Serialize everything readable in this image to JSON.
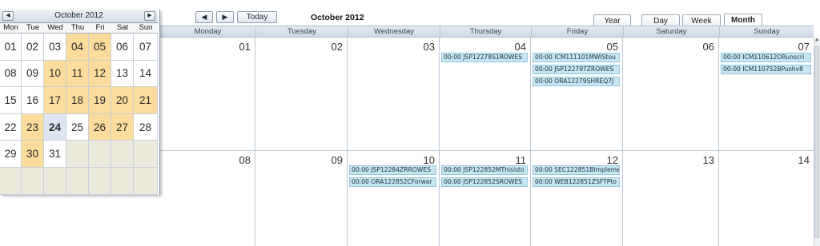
{
  "toolbar": {
    "prev_label": "◀",
    "next_label": "▶",
    "today_label": "Today",
    "month_title": "October 2012",
    "views": [
      "Year",
      "Day",
      "Week",
      "Month"
    ],
    "active_view": "Month"
  },
  "weekdays": [
    "Monday",
    "Tuesday",
    "Wednesday",
    "Thursday",
    "Friday",
    "Saturday",
    "Sunday"
  ],
  "weeks": [
    {
      "days": [
        {
          "num": "01",
          "events": []
        },
        {
          "num": "02",
          "events": []
        },
        {
          "num": "03",
          "events": []
        },
        {
          "num": "04",
          "events": [
            "00:00 JSP12278S1ROWES"
          ]
        },
        {
          "num": "05",
          "events": [
            "00:00 ICM111101MWIStou",
            "00:00 JSP12279TZROWES",
            "00:00 ORA12279SHREQ7J"
          ]
        },
        {
          "num": "06",
          "events": []
        },
        {
          "num": "07",
          "events": [
            "00:00 ICM110612ORunscri",
            "00:00 ICM110752BPushv8"
          ]
        }
      ]
    },
    {
      "days": [
        {
          "num": "08",
          "events": []
        },
        {
          "num": "09",
          "events": []
        },
        {
          "num": "10",
          "events": [
            "00:00 JSP12284ZRROWES",
            "00:00 ORA122852CForwar"
          ]
        },
        {
          "num": "11",
          "events": [
            "00:00 JSP122852MThisisto",
            "00:00 JSP122852SROWES"
          ]
        },
        {
          "num": "12",
          "events": [
            "00:00 SEC122851BImpleme",
            "00:00 WEB122851ZSFTPto"
          ]
        },
        {
          "num": "13",
          "events": []
        },
        {
          "num": "14",
          "events": []
        }
      ]
    }
  ],
  "mini_calendar": {
    "title": "October 2012",
    "prev_label": "◀",
    "next_label": "▶",
    "dow": [
      "Mon",
      "Tue",
      "Wed",
      "Thu",
      "Fri",
      "Sat",
      "Sun"
    ],
    "weeks": [
      [
        {
          "d": "01"
        },
        {
          "d": "02"
        },
        {
          "d": "03"
        },
        {
          "d": "04",
          "ev": true
        },
        {
          "d": "05",
          "ev": true
        },
        {
          "d": "06"
        },
        {
          "d": "07"
        }
      ],
      [
        {
          "d": "08"
        },
        {
          "d": "09"
        },
        {
          "d": "10",
          "ev": true
        },
        {
          "d": "11",
          "ev": true
        },
        {
          "d": "12",
          "ev": true
        },
        {
          "d": "13"
        },
        {
          "d": "14"
        }
      ],
      [
        {
          "d": "15"
        },
        {
          "d": "16"
        },
        {
          "d": "17",
          "ev": true
        },
        {
          "d": "18",
          "ev": true
        },
        {
          "d": "19",
          "ev": true
        },
        {
          "d": "20",
          "ev": true
        },
        {
          "d": "21",
          "ev": true
        }
      ],
      [
        {
          "d": "22"
        },
        {
          "d": "23",
          "ev": true
        },
        {
          "d": "24",
          "today": true
        },
        {
          "d": "25"
        },
        {
          "d": "26",
          "ev": true
        },
        {
          "d": "27",
          "ev": true
        },
        {
          "d": "28"
        }
      ],
      [
        {
          "d": "29"
        },
        {
          "d": "30",
          "ev": true
        },
        {
          "d": "31"
        },
        {
          "d": ""
        },
        {
          "d": ""
        },
        {
          "d": ""
        },
        {
          "d": ""
        }
      ],
      [
        {
          "d": ""
        },
        {
          "d": ""
        },
        {
          "d": ""
        },
        {
          "d": ""
        },
        {
          "d": ""
        },
        {
          "d": ""
        },
        {
          "d": ""
        }
      ]
    ]
  },
  "colors": {
    "event_bg": "#c5e6f2",
    "mini_event_bg": "#fbdc9d",
    "header_bg": "#cdd9e6"
  }
}
